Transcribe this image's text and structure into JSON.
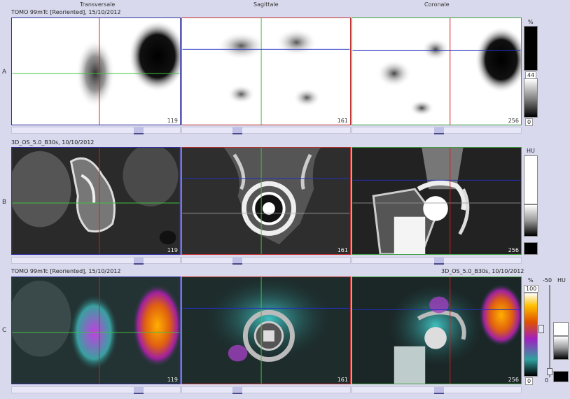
{
  "columns": [
    "Transversale",
    "Sagittale",
    "Coronale"
  ],
  "rows": {
    "A": {
      "label": "A",
      "series": "TOMO 99mTc [Reoriented], 15/10/2012",
      "slices": [
        "119",
        "161",
        "256"
      ]
    },
    "B": {
      "label": "B",
      "series": "3D_OS_5.0_B30s, 10/10/2012",
      "slices": [
        "119",
        "161",
        "256"
      ]
    },
    "C": {
      "label": "C",
      "series": "TOMO 99mTc [Reoriented], 15/10/2012",
      "series_right": "3D_OS_5.0_B30s, 10/10/2012",
      "slices": [
        "119",
        "161",
        "256"
      ]
    }
  },
  "scales": {
    "a": {
      "unit": "%",
      "value": "44",
      "min": "0"
    },
    "b": {
      "unit": "HU"
    },
    "c_left": {
      "unit": "%",
      "max": "100",
      "min": "0"
    },
    "c_right": {
      "unit": "HU",
      "value": "-50",
      "min": "0"
    }
  },
  "colors": {
    "trans_border": "#3030a0",
    "sag_border": "#c03030",
    "cor_border": "#40a040",
    "cross_red": "#d02020",
    "cross_green": "#40c040",
    "cross_blue": "#2030c0"
  }
}
